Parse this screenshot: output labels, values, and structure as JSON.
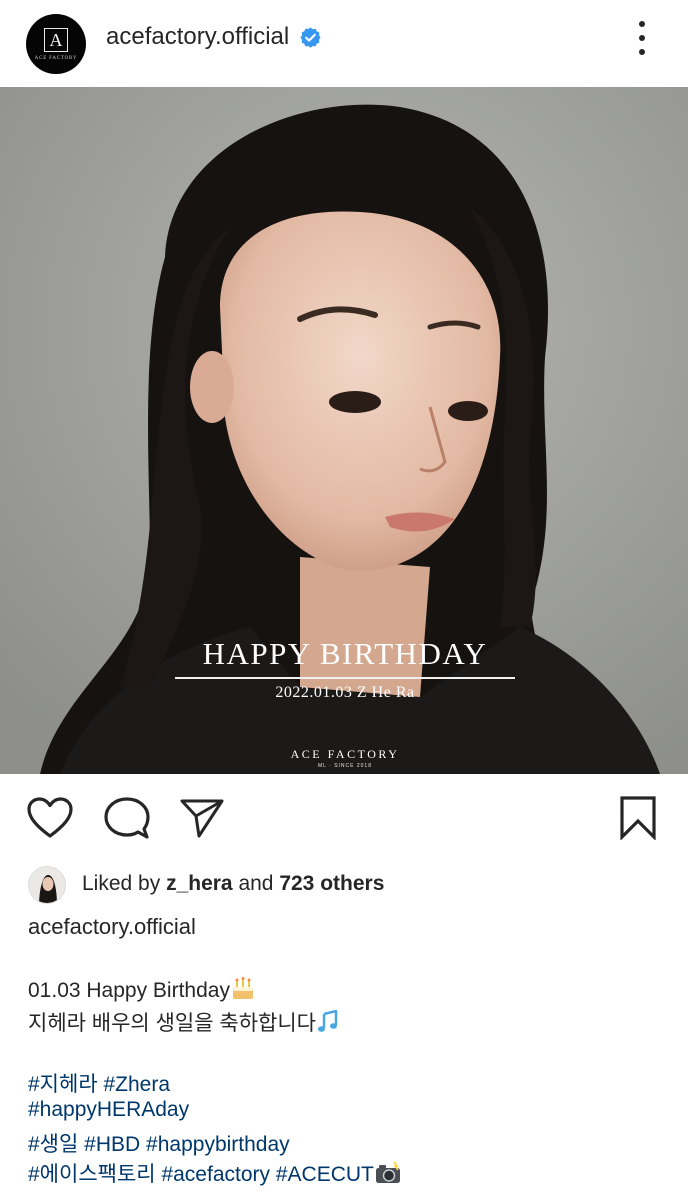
{
  "post": {
    "username": "acefactory.official",
    "avatar_text": "A",
    "avatar_subtext": "ACE FACTORY",
    "verified": true,
    "icons": {
      "verified": "verified-badge-icon",
      "more": "more-options-icon",
      "like": "heart-icon",
      "comment": "comment-icon",
      "share": "paper-plane-icon",
      "save": "bookmark-icon",
      "tag": "user-tag-icon"
    }
  },
  "image": {
    "headline": "HAPPY BIRTHDAY",
    "date_line": "2022.01.03 Z He Ra",
    "brand": "ACE FACTORY",
    "brand_sub": "ML · SINCE 2018"
  },
  "likes": {
    "prefix": "Liked by ",
    "user": "z_hera",
    "middle": " and ",
    "count": "723 others"
  },
  "caption": {
    "username": "acefactory.official",
    "line1": "01.03 Happy Birthday",
    "line2": "지헤라 배우의 생일을 축하합니다",
    "hashtags": {
      "line1": [
        "#지헤라",
        "#Zhera"
      ],
      "line2": [
        "#happyHERAday"
      ],
      "line3": [
        "#생일",
        "#HBD",
        "#happybirthday"
      ],
      "line4": [
        "#에이스팩토리",
        "#acefactory",
        "#ACECUT"
      ]
    }
  },
  "colors": {
    "text": "#262626",
    "hashtag": "#00376b",
    "verified": "#3897f0",
    "photo_bg": "#a9aaa6"
  }
}
